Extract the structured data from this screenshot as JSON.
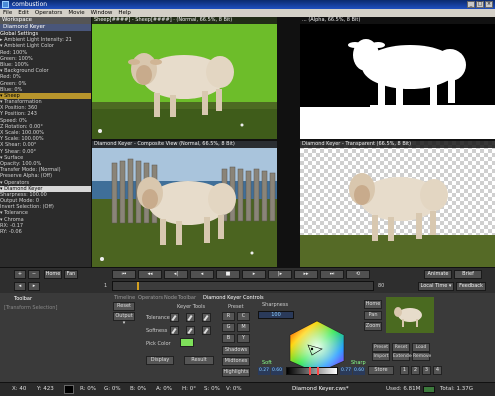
{
  "window": {
    "title": "combustion",
    "minimize": "_",
    "maximize": "□",
    "close": "×"
  },
  "menu": [
    "File",
    "Edit",
    "Operators",
    "Movie",
    "Window",
    "Help"
  ],
  "workspace": {
    "header": "Workspace",
    "selected": "Diamond Keyer",
    "items": [
      {
        "text": "Global Settings",
        "type": "section"
      },
      {
        "text": "▸ Ambient Light Intensity: 21",
        "type": "item"
      },
      {
        "text": "▾ Ambient Light Color",
        "type": "item"
      },
      {
        "text": "   Red: 100%",
        "type": "item"
      },
      {
        "text": "   Green: 100%",
        "type": "item"
      },
      {
        "text": "   Blue: 100%",
        "type": "item"
      },
      {
        "text": "▾ Background Color",
        "type": "item"
      },
      {
        "text": "   Red: 0%",
        "type": "item"
      },
      {
        "text": "   Green: 0%",
        "type": "item"
      },
      {
        "text": "   Blue: 0%",
        "type": "item"
      },
      {
        "text": "▾ Sheep",
        "type": "highlight"
      },
      {
        "text": "  ▾ Transformation",
        "type": "item"
      },
      {
        "text": "     X Position: 360",
        "type": "item"
      },
      {
        "text": "     Y Position: 243",
        "type": "item"
      },
      {
        "text": "     Speed: 0%",
        "type": "item"
      },
      {
        "text": "     Z Rotation: 0.00°",
        "type": "item"
      },
      {
        "text": "     X Scale: 100.00%",
        "type": "item"
      },
      {
        "text": "     Y Scale: 100.00%",
        "type": "item"
      },
      {
        "text": "     X Shear: 0.00°",
        "type": "item"
      },
      {
        "text": "     Y Shear: 0.00°",
        "type": "item"
      },
      {
        "text": "  ▾ Surface",
        "type": "item"
      },
      {
        "text": "     Opacity: 100.0%",
        "type": "item"
      },
      {
        "text": "     Transfer Mode: (Normal)",
        "type": "item"
      },
      {
        "text": "     Preserve Alpha: (Off)",
        "type": "item"
      },
      {
        "text": "  ▾ Operators",
        "type": "item"
      },
      {
        "text": "   ▾ Diamond Keyer",
        "type": "selected"
      },
      {
        "text": "      Sharpness: 100.00",
        "type": "item"
      },
      {
        "text": "      Output Mode: 0",
        "type": "item"
      },
      {
        "text": "      Invert Selection: (Off)",
        "type": "item"
      },
      {
        "text": "    ▾ Tolerance",
        "type": "item"
      },
      {
        "text": "     ▾ Chroma",
        "type": "item"
      },
      {
        "text": "        RX: -0.17",
        "type": "item"
      },
      {
        "text": "        RY: -0.06",
        "type": "item"
      }
    ]
  },
  "viewers": {
    "v1": "Sheep[####] - Sheep[####] · (Normal, 66.5%, 8 Bit)",
    "v2": "... (Alpha, 66.5%, 8 Bit)",
    "v3": "Diamond Keyer - Composite View (Normal, 66.5%, 8 Bit)",
    "v4": "Diamond Keyer - Transparent (66.5%, 8 Bit)"
  },
  "transport": {
    "frame_start": "1",
    "frame_end": "80",
    "current_frame": "20",
    "buttons": [
      "+",
      "−",
      "Home",
      "Fan"
    ],
    "animate": "Animate",
    "brief": "Brief",
    "local_time": "Local Time ▾",
    "feedback": "Feedback"
  },
  "controls": {
    "tabs": [
      "Timeline",
      "Operators",
      "Node",
      "Toolbar"
    ],
    "title": "Diamond Keyer Controls",
    "toolbar_label": "Toolbar",
    "toolbar_hint": "[Transform Selection]",
    "reset_label": "Reset",
    "output_label": "Output ▾",
    "keyer_tools": "Keyer Tools",
    "tolerance": "Tolerance",
    "softness": "Softness",
    "pick_color": "Pick Color",
    "display": "Display",
    "result": "Result",
    "preset": "Preset",
    "r": "R",
    "g": "G",
    "b": "B",
    "c": "C",
    "m": "M",
    "y": "Y",
    "shadows": "Shadows",
    "midtones": "Midtones",
    "highlights": "Highlights",
    "sharpness_label": "Sharpness",
    "sharpness_value": "100",
    "home": "Home",
    "pan": "Pan",
    "zoom": "Zoom",
    "store": "Store",
    "grid": [
      "Preset",
      "Reset",
      "Load",
      "Import",
      "Extended",
      "Remove"
    ],
    "min_vals": [
      "0.27",
      "0.60"
    ],
    "max_vals": [
      "0.77",
      "0.60"
    ],
    "soft_label": "Soft",
    "sharp_label": "Sharp"
  },
  "status": {
    "x": "X: 40",
    "y": "Y: 423",
    "r": "R: 0%",
    "g": "G: 0%",
    "b": "B: 0%",
    "a": "A: 0%",
    "h": "H: 0°",
    "s": "S: 0%",
    "v": "V: 0%",
    "file": "Diamond Keyer.cws*",
    "used": "Used: 6.81M",
    "total": "Total: 1.37G"
  }
}
